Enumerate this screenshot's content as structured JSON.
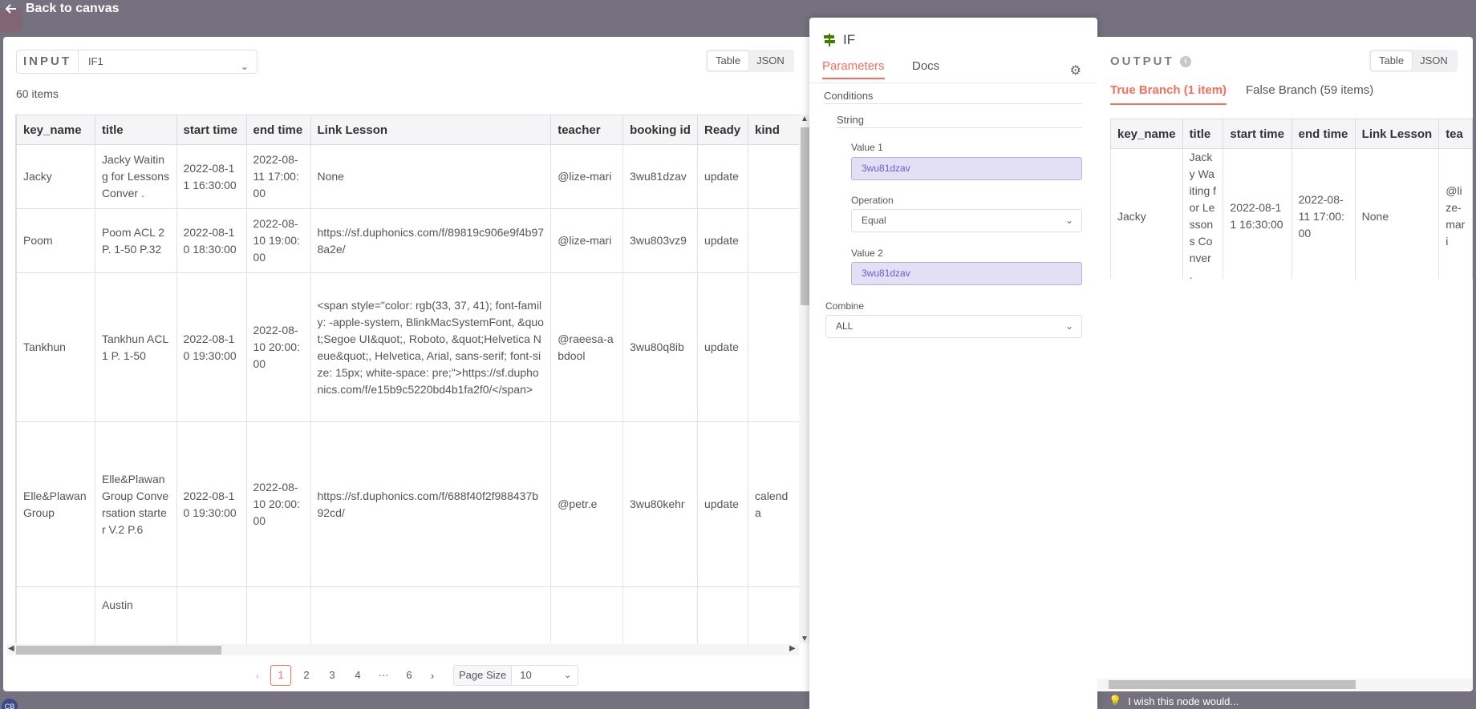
{
  "topbar": {
    "back_label": "Back to canvas"
  },
  "input": {
    "label": "INPUT",
    "node_select": "IF1",
    "view_table": "Table",
    "view_json": "JSON",
    "count": "60 items",
    "columns": [
      "key_name",
      "title",
      "start time",
      "end time",
      "Link Lesson",
      "teacher",
      "booking id",
      "Ready",
      "kind"
    ],
    "rows": [
      [
        "Jacky",
        "Jacky Waiting for Lessons Conver .",
        "2022-08-11 16:30:00",
        "2022-08-11 17:00:00",
        "None",
        "@lize-mari",
        "3wu81dzav",
        "update",
        ""
      ],
      [
        "Poom",
        "Poom ACL 2 P. 1-50 P.32",
        "2022-08-10 18:30:00",
        "2022-08-10 19:00:00",
        "https://sf.duphonics.com/f/89819c906e9f4b978a2e/",
        "@lize-mari",
        "3wu803vz9",
        "update",
        ""
      ],
      [
        "Tankhun",
        "Tankhun ACL 1 P. 1-50",
        "2022-08-10 19:30:00",
        "2022-08-10 20:00:00",
        "<span style=\"color: rgb(33, 37, 41); font-family: -apple-system, BlinkMacSystemFont, &quot;Segoe UI&quot;, Roboto, &quot;Helvetica Neue&quot;, Helvetica, Arial, sans-serif; font-size: 15px; white-space: pre;\">https://sf.duphonics.com/f/e15b9c5220bd4b1fa2f0/</span>",
        "@raeesa-abdool",
        "3wu80q8ib",
        "update",
        ""
      ],
      [
        "Elle&Plawan Group",
        "Elle&Plawan Group Conversation starter V.2 P.6",
        "2022-08-10 19:30:00",
        "2022-08-10 20:00:00",
        "https://sf.duphonics.com/f/688f40f2f988437b92cd/",
        "@petr.e",
        "3wu80kehr",
        "update",
        "calenda"
      ],
      [
        "",
        "Austin",
        "",
        "",
        "",
        "",
        "",
        "",
        ""
      ]
    ],
    "pagination": {
      "pages": [
        "1",
        "2",
        "3",
        "4",
        "···",
        "6"
      ],
      "page_size_label": "Page Size",
      "page_size": "10"
    }
  },
  "node": {
    "title": "IF",
    "tab_parameters": "Parameters",
    "tab_docs": "Docs",
    "conditions_label": "Conditions",
    "string_label": "String",
    "value1_label": "Value 1",
    "value1": "3wu81dzav",
    "operation_label": "Operation",
    "operation": "Equal",
    "value2_label": "Value 2",
    "value2": "3wu81dzav",
    "combine_label": "Combine",
    "combine": "ALL",
    "wish": "I wish this node would..."
  },
  "output": {
    "label": "OUTPUT",
    "view_table": "Table",
    "view_json": "JSON",
    "true_branch": "True Branch (1 item)",
    "false_branch": "False Branch (59 items)",
    "columns": [
      "key_name",
      "title",
      "start time",
      "end time",
      "Link Lesson",
      "tea"
    ],
    "rows": [
      [
        "Jacky",
        "Jacky Waiting for Lessons Conver .",
        "2022-08-11 16:30:00",
        "2022-08-11 17:00:00",
        "None",
        "@lize-mari"
      ]
    ]
  },
  "avatar_initials": "CB",
  "colors": {
    "accent": "#ff6d5a",
    "value_bg": "#e3e0f6",
    "value_text": "#6b5bd6"
  }
}
